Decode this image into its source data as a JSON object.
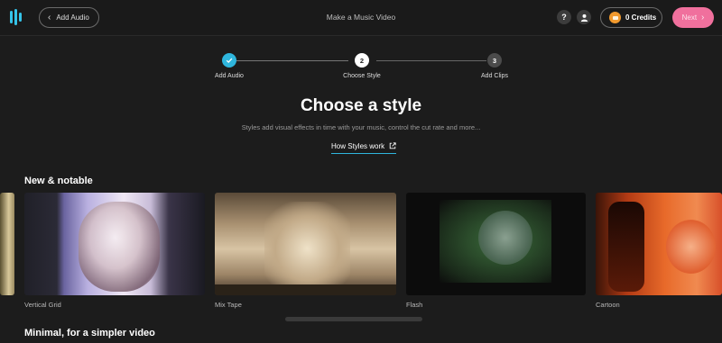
{
  "header": {
    "back_label": "Add Audio",
    "title": "Make a Music Video",
    "help_label": "?",
    "credits_label": "0 Credits",
    "next_label": "Next"
  },
  "stepper": {
    "steps": [
      {
        "number": "1",
        "label": "Add Audio",
        "state": "done"
      },
      {
        "number": "2",
        "label": "Choose Style",
        "state": "active"
      },
      {
        "number": "3",
        "label": "Add Clips",
        "state": "todo"
      }
    ]
  },
  "main": {
    "title": "Choose a style",
    "subtitle": "Styles add visual effects in time with your music, control the cut rate and more...",
    "how_link": "How Styles work"
  },
  "sections": [
    {
      "title": "New & notable",
      "cards": [
        {
          "label": "Vertical Grid"
        },
        {
          "label": "Mix Tape"
        },
        {
          "label": "Flash"
        },
        {
          "label": "Cartoon"
        }
      ]
    },
    {
      "title": "Minimal, for a simpler video"
    }
  ],
  "colors": {
    "accent": "#2fb6dd",
    "next_button": "#f0709d",
    "credits_coin": "#f29a2e"
  }
}
